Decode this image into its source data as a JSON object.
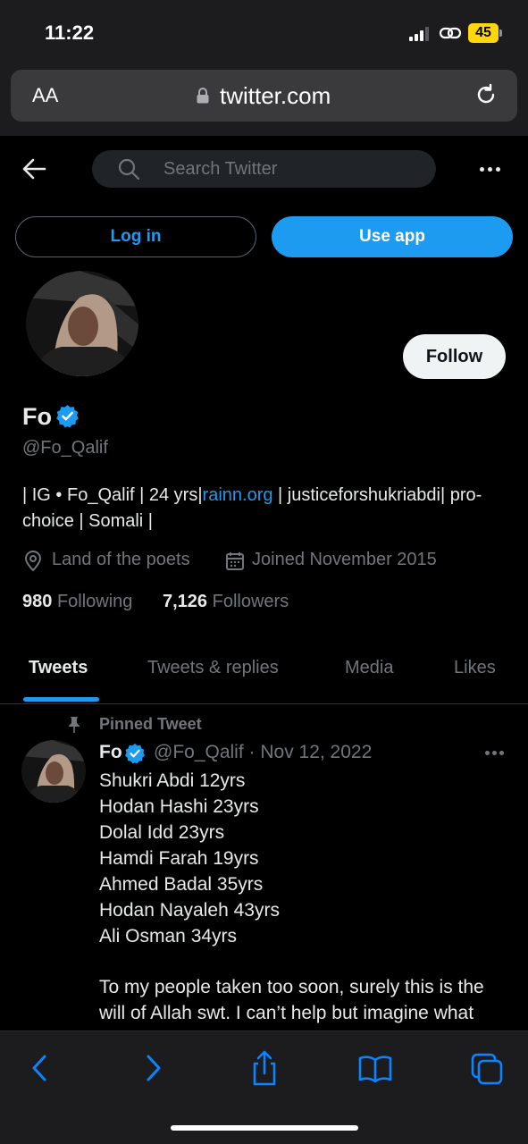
{
  "status_bar": {
    "time": "11:22",
    "battery": "45"
  },
  "browser": {
    "text_size_label": "AA",
    "domain": "twitter.com"
  },
  "header": {
    "search_placeholder": "Search Twitter"
  },
  "auth": {
    "login_label": "Log in",
    "use_app_label": "Use app"
  },
  "profile": {
    "follow_label": "Follow",
    "name": "Fo",
    "handle": "@Fo_Qalif",
    "bio_prefix": "| IG • Fo_Qalif | 24 yrs|",
    "bio_link": "rainn.org",
    "bio_suffix": " | justiceforshukriabdi| pro-choice | Somali |",
    "location": "Land of the poets",
    "joined": "Joined November 2015",
    "following_count": "980",
    "following_label": "Following",
    "followers_count": "7,126",
    "followers_label": "Followers"
  },
  "tabs": [
    {
      "label": "Tweets",
      "active": true
    },
    {
      "label": "Tweets & replies",
      "active": false
    },
    {
      "label": "Media",
      "active": false
    },
    {
      "label": "Likes",
      "active": false
    }
  ],
  "tweet": {
    "pinned_label": "Pinned Tweet",
    "author_name": "Fo",
    "author_handle_date": "@Fo_Qalif · Nov 12, 2022",
    "lines": [
      "Shukri Abdi 12yrs",
      "Hodan Hashi 23yrs",
      "Dolal Idd 23yrs",
      "Hamdi Farah 19yrs",
      "Ahmed Badal 35yrs",
      "Hodan Nayaleh 43yrs",
      "Ali Osman 34yrs"
    ],
    "paragraph": "To my people taken too soon, surely this is the will of Allah swt. I can’t help but imagine what"
  },
  "colors": {
    "accent": "#1d9bf0",
    "background": "#000000",
    "muted_text": "#71767b",
    "verified": "#1d9bf0"
  },
  "icons": [
    "back-arrow-icon",
    "search-icon",
    "more-icon",
    "verified-icon",
    "location-icon",
    "calendar-icon",
    "pin-icon",
    "share-icon",
    "bookmarks-icon",
    "tabs-icon"
  ]
}
